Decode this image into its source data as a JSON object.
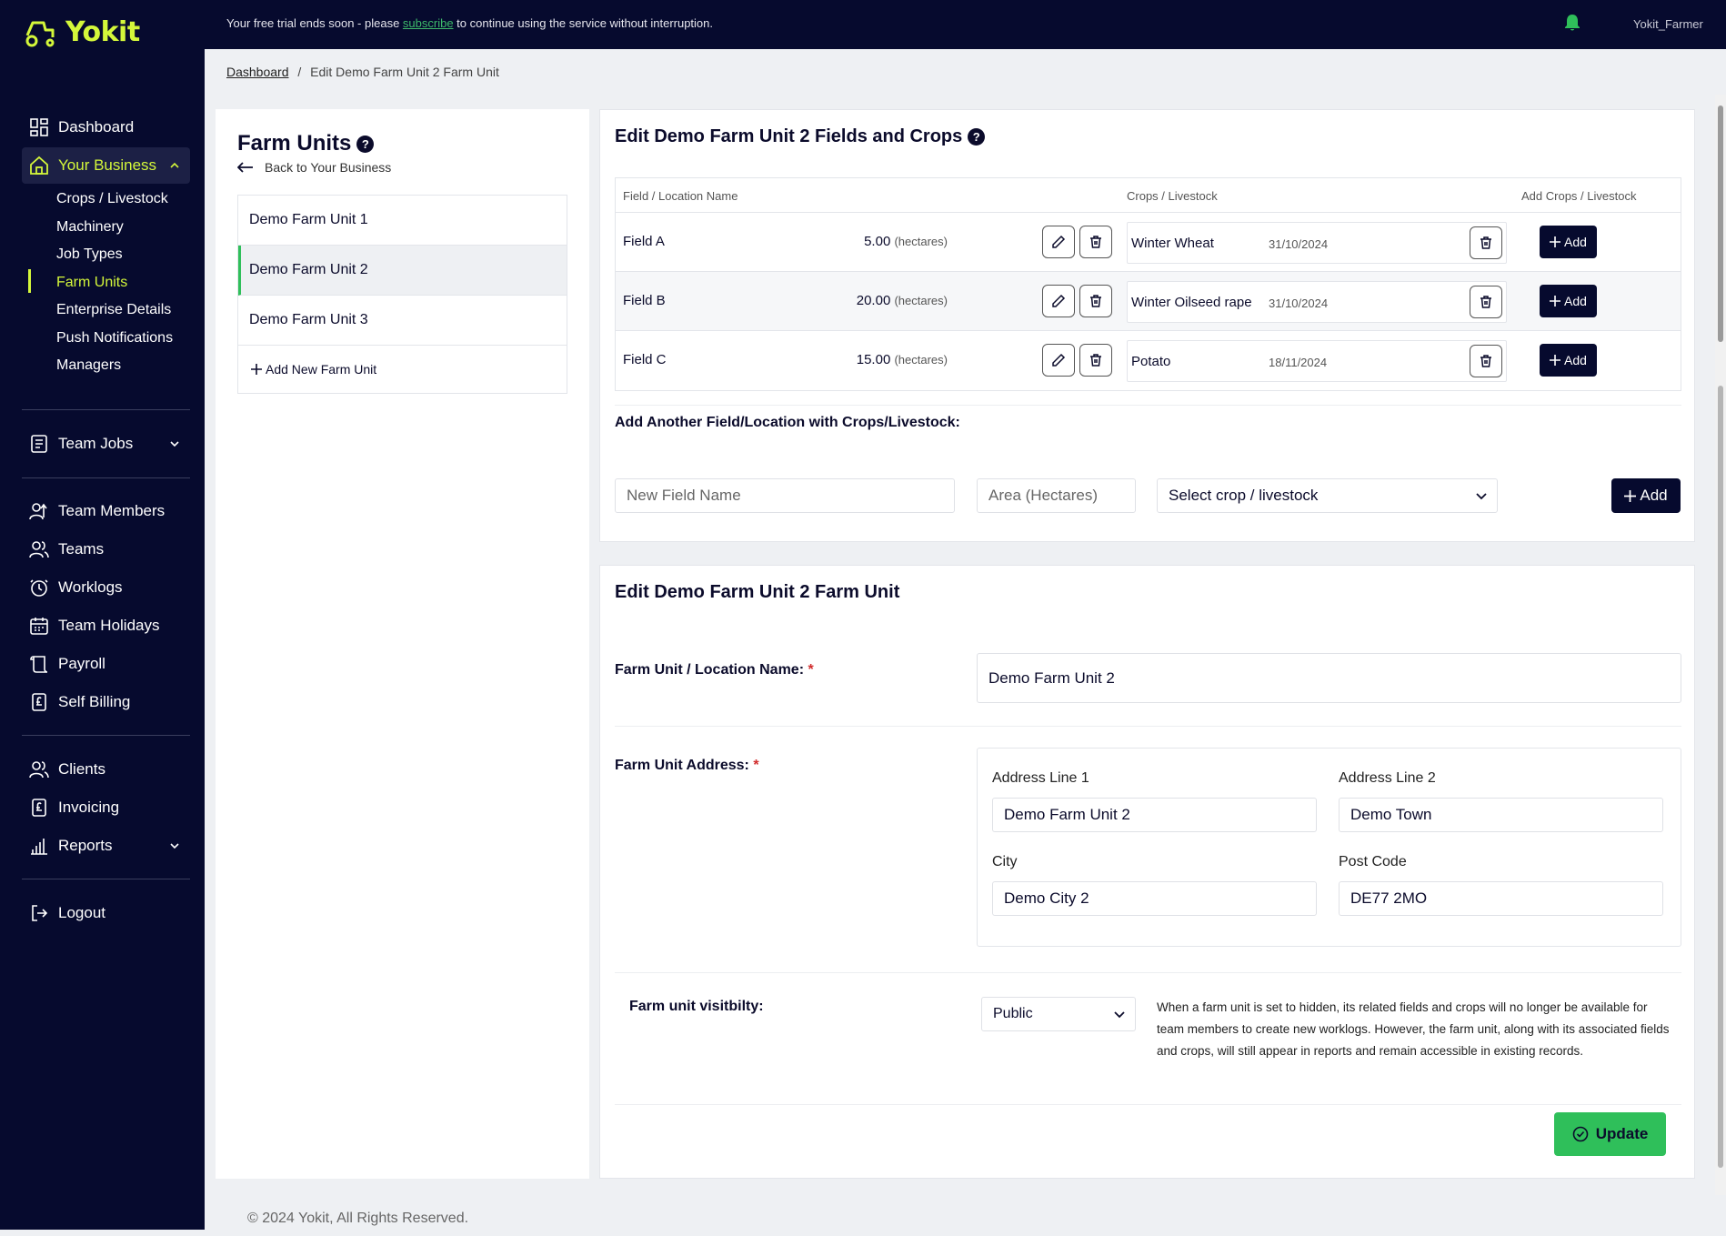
{
  "app": {
    "logo_text": "Yokit",
    "brand_color": "#d4f73a",
    "sidebar_bg": "#060a2e"
  },
  "topbar": {
    "trial_prefix": "Your free trial ends soon - please ",
    "trial_link": "subscribe",
    "trial_suffix": " to continue using the service without interruption.",
    "username": "Yokit_Farmer"
  },
  "sidebar": {
    "dashboard": "Dashboard",
    "your_business": "Your Business",
    "sub_items": [
      "Crops / Livestock",
      "Machinery",
      "Job Types",
      "Farm Units",
      "Enterprise Details",
      "Push Notifications",
      "Managers"
    ],
    "team_jobs": "Team Jobs",
    "team_members": "Team Members",
    "teams": "Teams",
    "worklogs": "Worklogs",
    "team_holidays": "Team Holidays",
    "payroll": "Payroll",
    "self_billing": "Self Billing",
    "clients": "Clients",
    "invoicing": "Invoicing",
    "reports": "Reports",
    "logout": "Logout"
  },
  "breadcrumb": {
    "home": "Dashboard",
    "sep": "/",
    "current": "Edit Demo Farm Unit 2 Farm Unit"
  },
  "farm_units": {
    "title": "Farm Units",
    "back": "Back to Your Business",
    "items": [
      "Demo Farm Unit 1",
      "Demo Farm Unit 2",
      "Demo Farm Unit 3"
    ],
    "selected_index": 1,
    "add_new": "Add New Farm Unit"
  },
  "fields_card": {
    "title": "Edit Demo Farm Unit 2 Fields and Crops",
    "col_field": "Field / Location Name",
    "col_crops": "Crops / Livestock",
    "col_add": "Add Crops / Livestock",
    "unit": "(hectares)",
    "add_label": "Add",
    "rows": [
      {
        "name": "Field A",
        "area": "5.00",
        "crop": "Winter Wheat",
        "date": "31/10/2024"
      },
      {
        "name": "Field B",
        "area": "20.00",
        "crop": "Winter Oilseed rape",
        "date": "31/10/2024"
      },
      {
        "name": "Field C",
        "area": "15.00",
        "crop": "Potato",
        "date": "18/11/2024"
      }
    ],
    "add_another_title": "Add Another Field/Location with Crops/Livestock:",
    "new_field_placeholder": "New Field Name",
    "area_placeholder": "Area (Hectares)",
    "crop_select": "Select crop / livestock",
    "add_button": "Add"
  },
  "unit_card": {
    "title": "Edit Demo Farm Unit 2 Farm Unit",
    "name_label": "Farm Unit / Location Name:",
    "name_value": "Demo Farm Unit 2",
    "address_label": "Farm Unit Address:",
    "required": "*",
    "address_line1_label": "Address Line 1",
    "address_line1": "Demo Farm Unit 2",
    "address_line2_label": "Address Line 2",
    "address_line2": "Demo Town",
    "city_label": "City",
    "city": "Demo City 2",
    "postcode_label": "Post Code",
    "postcode": "DE77 2MO",
    "visibility_label": "Farm unit visitbilty:",
    "visibility_value": "Public",
    "visibility_note": "When a farm unit is set to hidden, its related fields and crops will no longer be available for team members to create new worklogs. However, the farm unit, along with its associated fields and crops, will still appear in reports and remain accessible in existing records.",
    "update": "Update"
  },
  "footer": "© 2024 Yokit, All Rights Reserved."
}
